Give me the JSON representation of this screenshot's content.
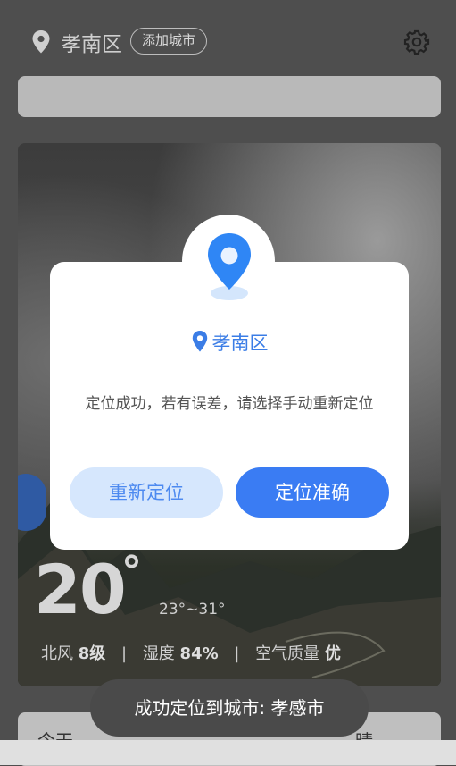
{
  "header": {
    "city": "孝南区",
    "add_city": "添加城市"
  },
  "weather": {
    "temperature": "20",
    "degree": "°",
    "range": "23°~31°",
    "wind_label": "北风",
    "wind_value": "8级",
    "humidity_label": "湿度",
    "humidity_value": "84%",
    "aqi_label": "空气质量",
    "aqi_value": "优"
  },
  "dialog": {
    "city": "孝南区",
    "message": "定位成功，若有误差，请选择手动重新定位",
    "relocate_button": "重新定位",
    "accurate_button": "定位准确"
  },
  "toast": "成功定位到城市: 孝感市",
  "bottom_card": {
    "left_text": "今天",
    "right_text": "晴"
  },
  "colors": {
    "accent": "#3a7cf3",
    "accent_light": "#d6e7fd",
    "overlay_bg": "#4e4e4e"
  }
}
